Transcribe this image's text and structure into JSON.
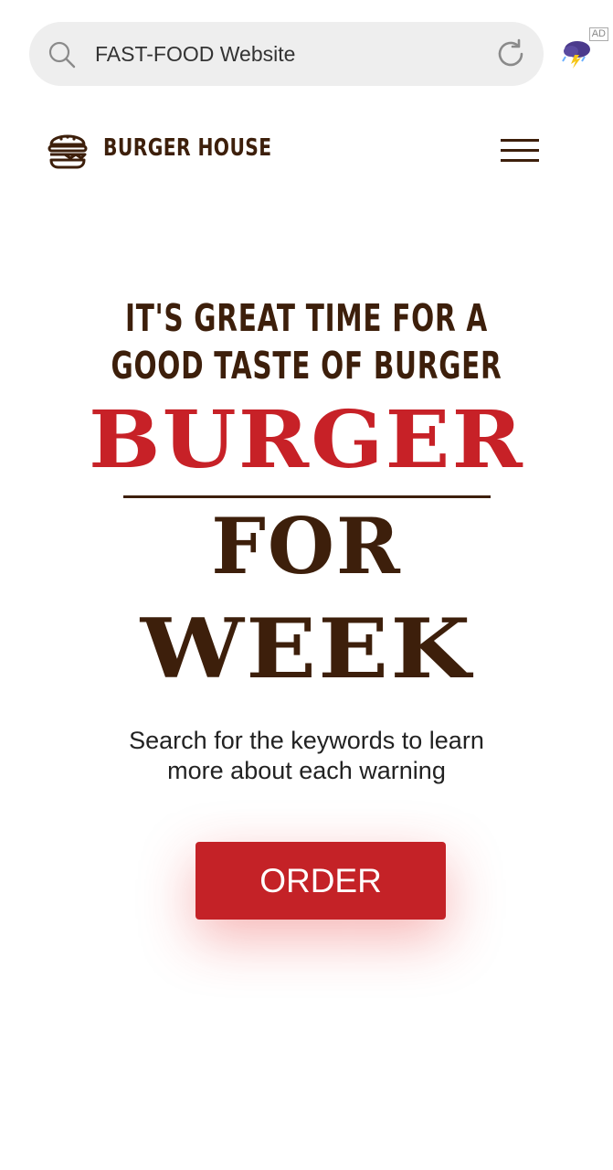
{
  "browser": {
    "search_text": "FAST-FOOD Website",
    "ad_label": "AD",
    "icons": [
      "search-icon",
      "reload-icon",
      "storm-cloud-icon"
    ]
  },
  "header": {
    "brand": "BURGER HOUSE",
    "logo_icon": "burger-icon",
    "menu_icon": "hamburger-menu-icon"
  },
  "hero": {
    "tagline_line1": "IT'S GREAT TIME FOR A",
    "tagline_line2": "GOOD TASTE OF BURGER",
    "word1": "BURGER",
    "word2": "FOR",
    "word3": "WEEK",
    "desc_line1": "Search for the keywords to learn",
    "desc_line2": "more about each warning",
    "order_label": "ORDER"
  },
  "colors": {
    "brand_brown": "#3d1f0b",
    "accent_red": "#c42227",
    "search_bg": "#eeeeee"
  }
}
